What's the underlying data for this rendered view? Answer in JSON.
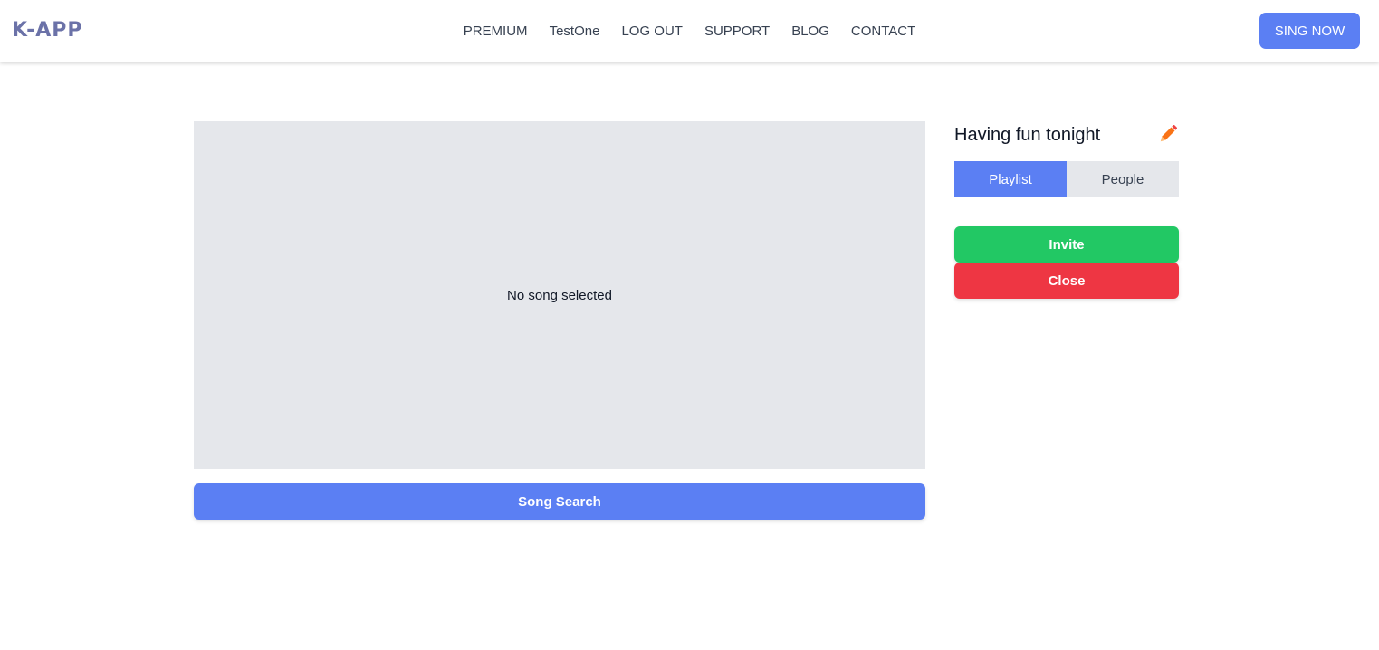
{
  "header": {
    "logo": "K-APP",
    "nav": [
      {
        "label": "PREMIUM"
      },
      {
        "label": "TestOne"
      },
      {
        "label": "LOG OUT"
      },
      {
        "label": "SUPPORT"
      },
      {
        "label": "BLOG"
      },
      {
        "label": "CONTACT"
      }
    ],
    "cta_label": "SING NOW"
  },
  "player": {
    "empty_text": "No song selected",
    "search_label": "Song Search"
  },
  "room": {
    "title": "Having fun tonight",
    "edit_icon": "pencil-icon",
    "tabs": [
      {
        "label": "Playlist",
        "active": true
      },
      {
        "label": "People",
        "active": false
      }
    ],
    "invite_label": "Invite",
    "close_label": "Close"
  },
  "colors": {
    "primary": "#5b7ff3",
    "invite": "#22c864",
    "close": "#ee3643",
    "panel": "#e5e7eb",
    "logo": "#6b72a8",
    "edit_icon": "#f97316"
  }
}
